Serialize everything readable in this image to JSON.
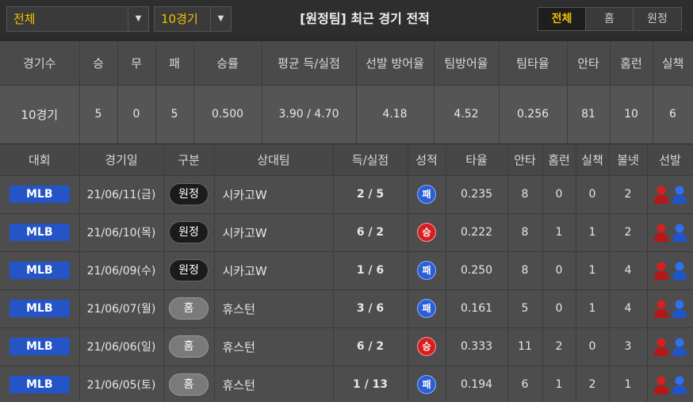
{
  "filters": {
    "category": "전체",
    "games": "10경기"
  },
  "title": "[원정팀] 최근 경기 전적",
  "tabs": [
    "전체",
    "홈",
    "원정"
  ],
  "summary": {
    "headers": [
      "경기수",
      "승",
      "무",
      "패",
      "승률",
      "평균 득/실점",
      "선발 방어율",
      "팀방어율",
      "팀타율",
      "안타",
      "홈런",
      "실책"
    ],
    "values": [
      "10경기",
      "5",
      "0",
      "5",
      "0.500",
      "3.90 / 4.70",
      "4.18",
      "4.52",
      "0.256",
      "81",
      "10",
      "6"
    ]
  },
  "games": {
    "headers": [
      "대회",
      "경기일",
      "구분",
      "상대팀",
      "득/실점",
      "성적",
      "타율",
      "안타",
      "홈런",
      "실책",
      "볼넷",
      "선발"
    ],
    "rows": [
      {
        "league": "MLB",
        "date": "21/06/11(금)",
        "type": "원정",
        "opponent": "시카고W",
        "score": "2 / 5",
        "result": "패",
        "avg": "0.235",
        "hits": "8",
        "hr": "0",
        "err": "0",
        "bb": "2"
      },
      {
        "league": "MLB",
        "date": "21/06/10(목)",
        "type": "원정",
        "opponent": "시카고W",
        "score": "6 / 2",
        "result": "승",
        "avg": "0.222",
        "hits": "8",
        "hr": "1",
        "err": "1",
        "bb": "2"
      },
      {
        "league": "MLB",
        "date": "21/06/09(수)",
        "type": "원정",
        "opponent": "시카고W",
        "score": "1 / 6",
        "result": "패",
        "avg": "0.250",
        "hits": "8",
        "hr": "0",
        "err": "1",
        "bb": "4"
      },
      {
        "league": "MLB",
        "date": "21/06/07(월)",
        "type": "홈",
        "opponent": "휴스턴",
        "score": "3 / 6",
        "result": "패",
        "avg": "0.161",
        "hits": "5",
        "hr": "0",
        "err": "1",
        "bb": "4"
      },
      {
        "league": "MLB",
        "date": "21/06/06(일)",
        "type": "홈",
        "opponent": "휴스턴",
        "score": "6 / 2",
        "result": "승",
        "avg": "0.333",
        "hits": "11",
        "hr": "2",
        "err": "0",
        "bb": "3"
      },
      {
        "league": "MLB",
        "date": "21/06/05(토)",
        "type": "홈",
        "opponent": "휴스턴",
        "score": "1 / 13",
        "result": "패",
        "avg": "0.194",
        "hits": "6",
        "hr": "1",
        "err": "2",
        "bb": "1"
      }
    ]
  },
  "colors": {
    "accent": "#f2c200",
    "win": "#d42020",
    "lose": "#2b5fd6",
    "league": "#2454c6"
  }
}
